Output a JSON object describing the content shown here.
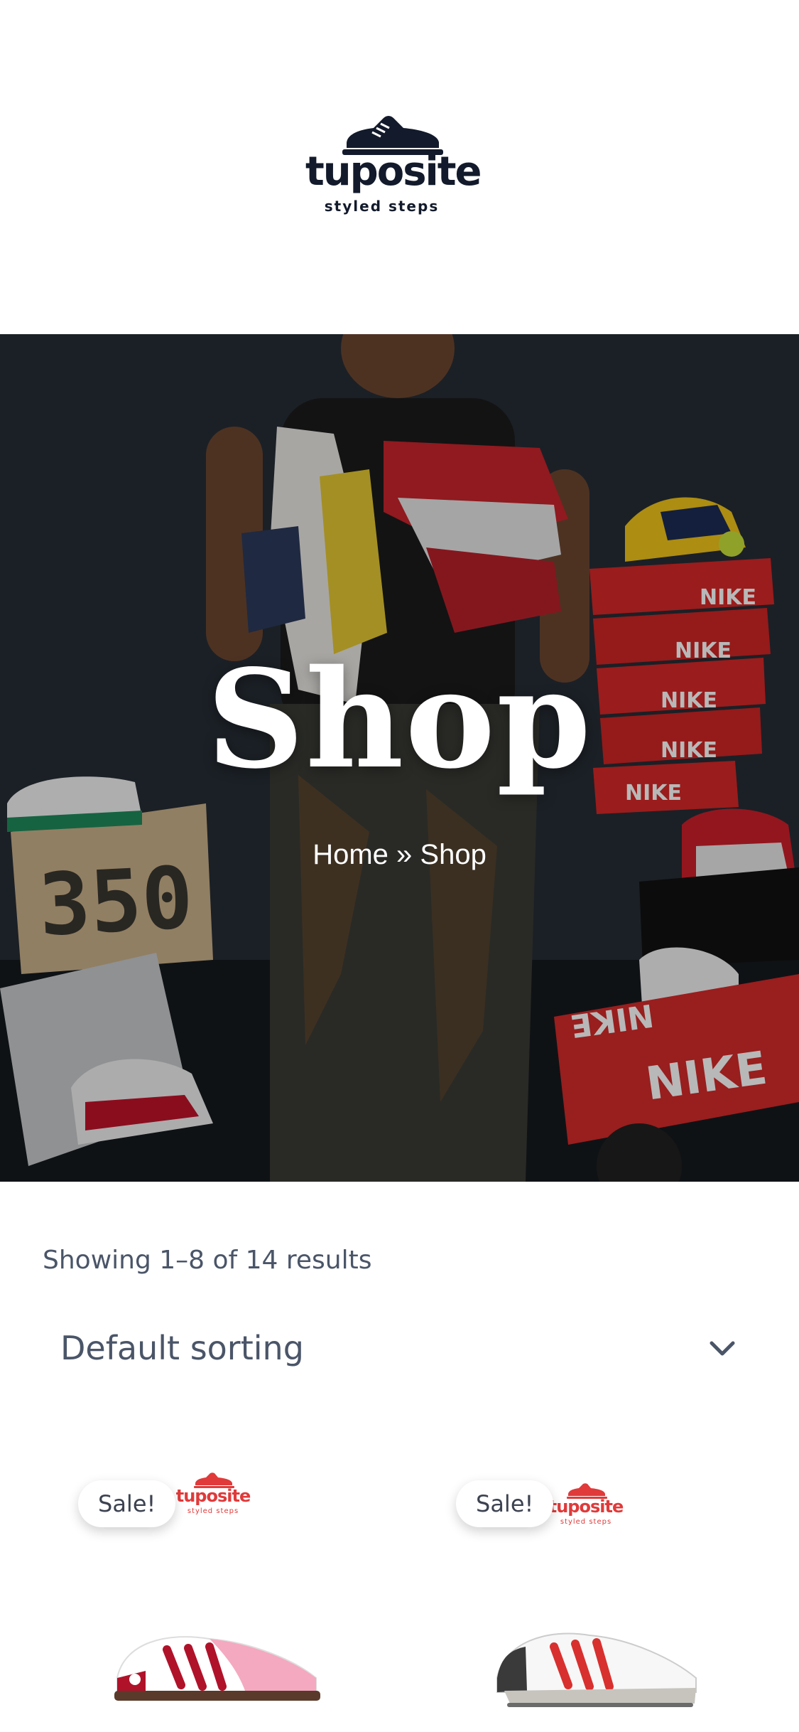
{
  "brand": {
    "name": "tuposite",
    "tagline": "styled steps",
    "color": "#121a2b",
    "accent": "#e03a3a"
  },
  "hero": {
    "title": "Shop",
    "breadcrumb": {
      "home": "Home",
      "separator": "»",
      "current": "Shop"
    },
    "box_label": "350",
    "shoe_box_brand": "NIKE"
  },
  "results": {
    "count_text": "Showing 1–8 of 14 results"
  },
  "sorting": {
    "selected": "Default sorting",
    "icon": "chevron-down-icon"
  },
  "products": [
    {
      "badge": "Sale!",
      "logo_word": "tuposite",
      "logo_tag": "styled steps",
      "shoe_colors": [
        "#b0122a",
        "#f4a9c0",
        "#ffffff",
        "#5a3a2a"
      ]
    },
    {
      "badge": "Sale!",
      "logo_word": "tuposite",
      "logo_tag": "styled steps",
      "shoe_colors": [
        "#d8302e",
        "#ffffff",
        "#c7c4be",
        "#6b6b6b"
      ]
    }
  ]
}
